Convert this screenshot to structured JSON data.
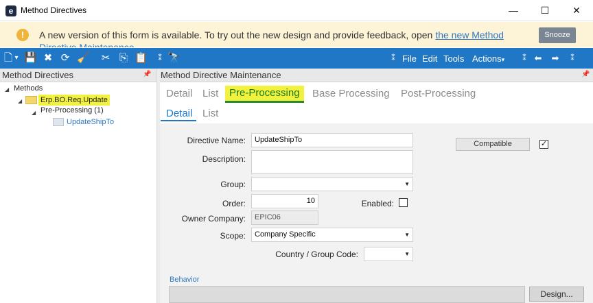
{
  "window": {
    "title": "Method Directives",
    "logo": "e",
    "controls": {
      "minimize": "—",
      "maximize": "☐",
      "close": "✕"
    }
  },
  "notification": {
    "icon": "!",
    "text": "A new version of this form is available. To try out the new design and provide feedback, open",
    "link": "the new Method",
    "overflow_text": "Directive Maintenance",
    "snooze": "Snooze"
  },
  "toolbar": {
    "icons": [
      "new-icon",
      "dropdown-icon",
      "save-icon",
      "delete-icon",
      "refresh-icon",
      "clear-icon",
      "cut-icon",
      "copy-icon",
      "paste-icon",
      "overflow-icon",
      "binoculars-icon"
    ],
    "glyphs": {
      "new": "🗋",
      "dd": "▾",
      "save": "💾",
      "delete": "✖",
      "refresh": "⟳",
      "clear": "🧹",
      "cut": "✂",
      "copy": "⎘",
      "paste": "📋",
      "more": "⁑",
      "search": "🔭",
      "back": "⬅",
      "forward": "➡"
    },
    "menu": {
      "file": "File",
      "edit": "Edit",
      "tools": "Tools",
      "actions": "Actions"
    },
    "actions_caret": "▾",
    "accent": "#1f77c5"
  },
  "left_panel": {
    "title": "Method Directives",
    "pin": "📌",
    "tree": {
      "root": "Methods",
      "child": "Erp.BO.Req.Update",
      "grandchild": "Pre-Processing (1)",
      "leaf": "UpdateShipTo"
    },
    "expand_glyph": "◢"
  },
  "right_panel": {
    "title": "Method Directive Maintenance",
    "pin": "📌",
    "close": "✕",
    "tabs": [
      "Detail",
      "List",
      "Pre-Processing",
      "Base Processing",
      "Post-Processing"
    ],
    "active_tab": "Pre-Processing",
    "subtabs": [
      "Detail",
      "List"
    ],
    "active_subtab": "Detail"
  },
  "form": {
    "directive_name_label": "Directive Name:",
    "directive_name_value": "UpdateShipTo",
    "description_label": "Description:",
    "description_value": "",
    "group_label": "Group:",
    "group_value": "",
    "order_label": "Order:",
    "order_value": "10",
    "enabled_label": "Enabled:",
    "enabled_checked": false,
    "owner_company_label": "Owner Company:",
    "owner_company_value": "EPIC06",
    "scope_label": "Scope:",
    "scope_value": "Company Specific",
    "country_label": "Country / Group Code:",
    "country_value": "",
    "compatible_label": "Compatible",
    "compatible_checked": true,
    "check_glyph": "✓",
    "dropdown_glyph": "▼",
    "behavior_label": "Behavior",
    "design_button": "Design..."
  }
}
